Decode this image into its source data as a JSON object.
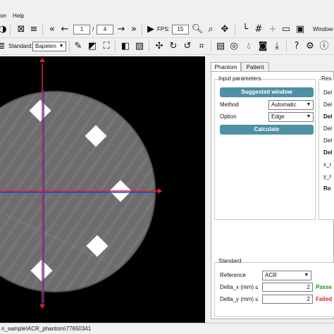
{
  "menu": {
    "partial_item": "on",
    "help": "Help"
  },
  "toolbar": {
    "page_current": "1",
    "page_separator": "/",
    "page_total": "4",
    "fps_label": "FPS:",
    "fps_value": "15",
    "window_label": "Window"
  },
  "toolbar2": {
    "standard_label": "Standard:",
    "standard_value": "Bapeten"
  },
  "tabs": {
    "phantom": "Phantom",
    "patient": "Patient"
  },
  "input_parameters": {
    "title": "Input parameters",
    "suggested_window": "Suggested window",
    "method_label": "Method",
    "method_value": "Automatic",
    "option_label": "Option",
    "option_value": "Edge",
    "calculate": "Calculate"
  },
  "results": {
    "title_partial": "Res",
    "rows": [
      "Del",
      "Del",
      "Del",
      "Del",
      "Del",
      "Del"
    ],
    "x_label": "x_r",
    "y_label": "y_r",
    "rot_label": "Ro"
  },
  "standard_group": {
    "title": "Standard",
    "reference_label": "Reference",
    "reference_value": "ACR",
    "delta_x_label": "Delta_x (mm) ≤",
    "delta_x_value": "2",
    "delta_x_result": "Passe",
    "delta_y_label": "Delta_y (mm) ≤",
    "delta_y_value": "2",
    "delta_y_result": "Failed"
  },
  "status": {
    "path": "n_sample\\ACR_phantom\\77650341"
  },
  "colors": {
    "accent": "#4f8fa8",
    "pass": "#1a8f1a",
    "fail": "#d42020",
    "crosshair_red": "#e0202a",
    "crosshair_blue": "#2a3ad8"
  }
}
